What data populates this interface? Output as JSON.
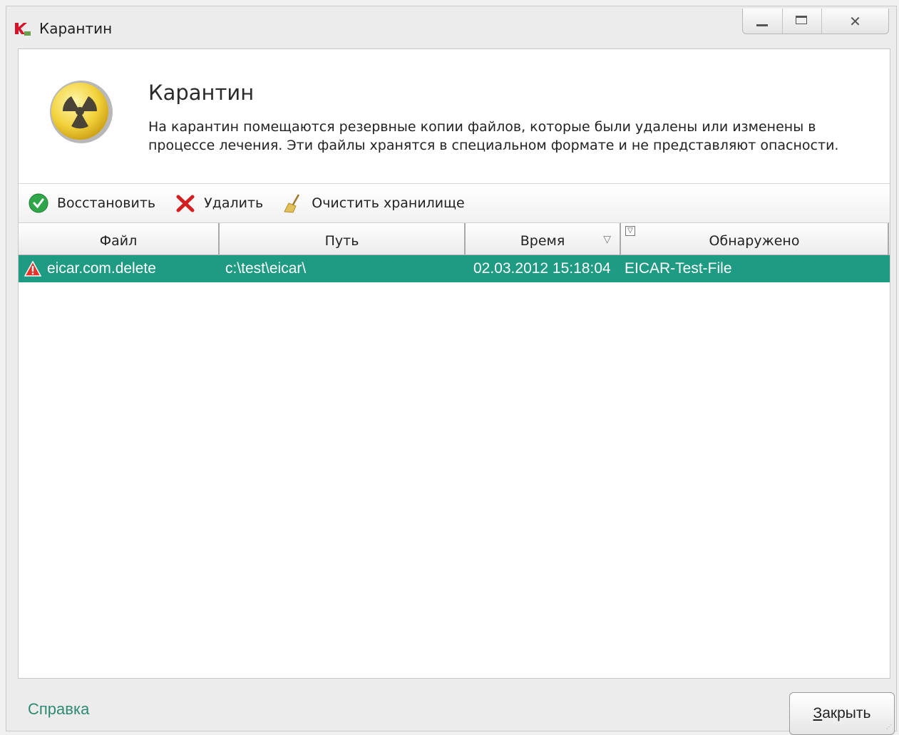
{
  "window": {
    "title": "Карантин",
    "controls": {
      "minimize": "—",
      "maximize": "□",
      "close": "✕"
    }
  },
  "header": {
    "title": "Карантин",
    "description": "На карантин помещаются резервные копии файлов, которые были удалены или изменены в процессе лечения. Эти файлы хранятся в специальном формате и не представляют опасности."
  },
  "toolbar": {
    "restore_label": "Восстановить",
    "delete_label": "Удалить",
    "clear_label": "Очистить хранилище"
  },
  "table": {
    "columns": [
      "Файл",
      "Путь",
      "Время",
      "Обнаружено"
    ],
    "sort_indicator": "▽",
    "rows": [
      {
        "file": "eicar.com.delete",
        "path": "c:\\test\\eicar\\",
        "time": "02.03.2012 15:18:04",
        "detected": "EICAR-Test-File",
        "selected": true
      }
    ]
  },
  "footer": {
    "help_label": "Справка",
    "close_prefix": "З",
    "close_rest": "акрыть"
  },
  "colors": {
    "selection": "#1f9a83",
    "link": "#2e8a72",
    "hazard": "#f2d23b"
  }
}
